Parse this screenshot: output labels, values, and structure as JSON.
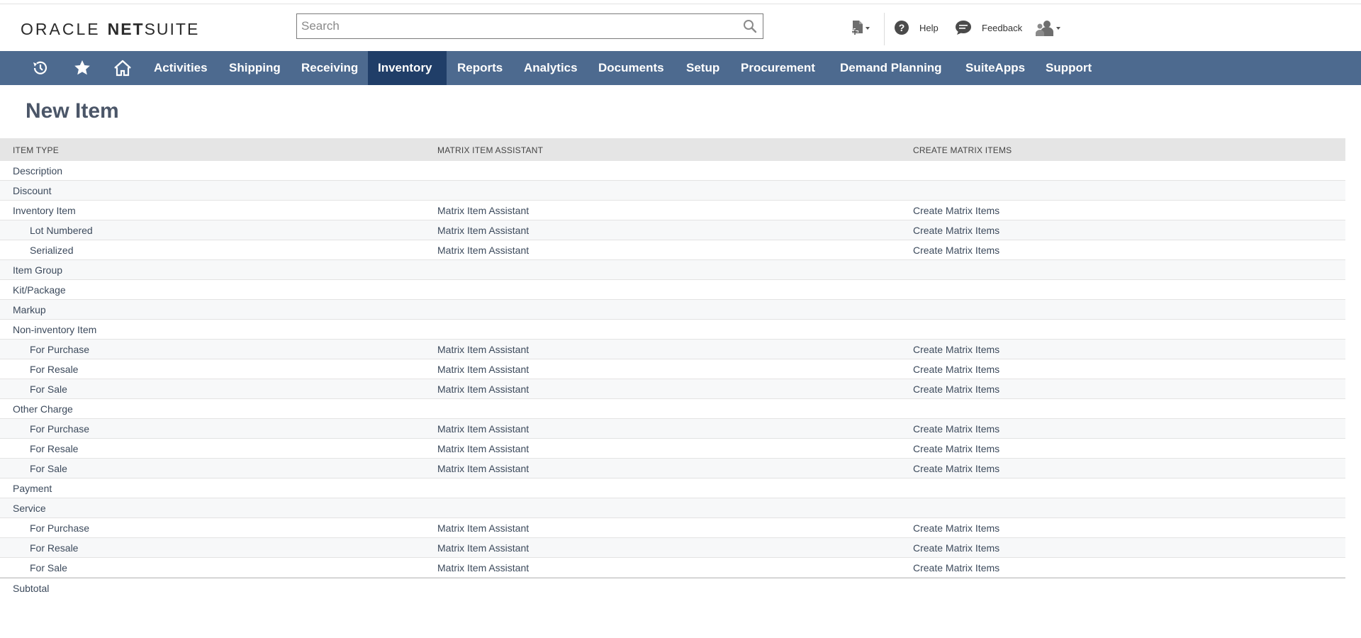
{
  "brand": {
    "oracle": "ORACLE",
    "net": "NET",
    "suite": "SUITE"
  },
  "search": {
    "placeholder": "Search",
    "value": ""
  },
  "header": {
    "help_label": "Help",
    "feedback_label": "Feedback"
  },
  "nav": {
    "items": [
      "Activities",
      "Shipping",
      "Receiving",
      "Inventory",
      "Reports",
      "Analytics",
      "Documents",
      "Setup",
      "Procurement",
      "Demand Planning",
      "SuiteApps",
      "Support"
    ],
    "active": "Inventory"
  },
  "page": {
    "title": "New Item"
  },
  "table": {
    "headers": [
      "ITEM TYPE",
      "MATRIX ITEM ASSISTANT",
      "CREATE MATRIX ITEMS"
    ],
    "rows": [
      {
        "type": "Description",
        "indent": false,
        "assistant": "",
        "create": ""
      },
      {
        "type": "Discount",
        "indent": false,
        "assistant": "",
        "create": ""
      },
      {
        "type": "Inventory Item",
        "indent": false,
        "assistant": "Matrix Item Assistant",
        "create": "Create Matrix Items"
      },
      {
        "type": "Lot Numbered",
        "indent": true,
        "assistant": "Matrix Item Assistant",
        "create": "Create Matrix Items"
      },
      {
        "type": "Serialized",
        "indent": true,
        "assistant": "Matrix Item Assistant",
        "create": "Create Matrix Items"
      },
      {
        "type": "Item Group",
        "indent": false,
        "assistant": "",
        "create": ""
      },
      {
        "type": "Kit/Package",
        "indent": false,
        "assistant": "",
        "create": ""
      },
      {
        "type": "Markup",
        "indent": false,
        "assistant": "",
        "create": ""
      },
      {
        "type": "Non-inventory Item",
        "indent": false,
        "assistant": "",
        "create": ""
      },
      {
        "type": "For Purchase",
        "indent": true,
        "assistant": "Matrix Item Assistant",
        "create": "Create Matrix Items"
      },
      {
        "type": "For Resale",
        "indent": true,
        "assistant": "Matrix Item Assistant",
        "create": "Create Matrix Items"
      },
      {
        "type": "For Sale",
        "indent": true,
        "assistant": "Matrix Item Assistant",
        "create": "Create Matrix Items"
      },
      {
        "type": "Other Charge",
        "indent": false,
        "assistant": "",
        "create": ""
      },
      {
        "type": "For Purchase",
        "indent": true,
        "assistant": "Matrix Item Assistant",
        "create": "Create Matrix Items"
      },
      {
        "type": "For Resale",
        "indent": true,
        "assistant": "Matrix Item Assistant",
        "create": "Create Matrix Items"
      },
      {
        "type": "For Sale",
        "indent": true,
        "assistant": "Matrix Item Assistant",
        "create": "Create Matrix Items"
      },
      {
        "type": "Payment",
        "indent": false,
        "assistant": "",
        "create": ""
      },
      {
        "type": "Service",
        "indent": false,
        "assistant": "",
        "create": ""
      },
      {
        "type": "For Purchase",
        "indent": true,
        "assistant": "Matrix Item Assistant",
        "create": "Create Matrix Items"
      },
      {
        "type": "For Resale",
        "indent": true,
        "assistant": "Matrix Item Assistant",
        "create": "Create Matrix Items"
      },
      {
        "type": "For Sale",
        "indent": true,
        "assistant": "Matrix Item Assistant",
        "create": "Create Matrix Items"
      }
    ],
    "footer": "Subtotal"
  },
  "colors": {
    "nav_bg": "#4d6a8f",
    "nav_active": "#203e68",
    "title": "#4b5668",
    "link": "#3c4a5c"
  },
  "icons": [
    "search-icon",
    "create-new-icon",
    "help-icon",
    "feedback-icon",
    "roles-icon",
    "recent-records-icon",
    "shortcuts-star-icon",
    "home-icon"
  ]
}
